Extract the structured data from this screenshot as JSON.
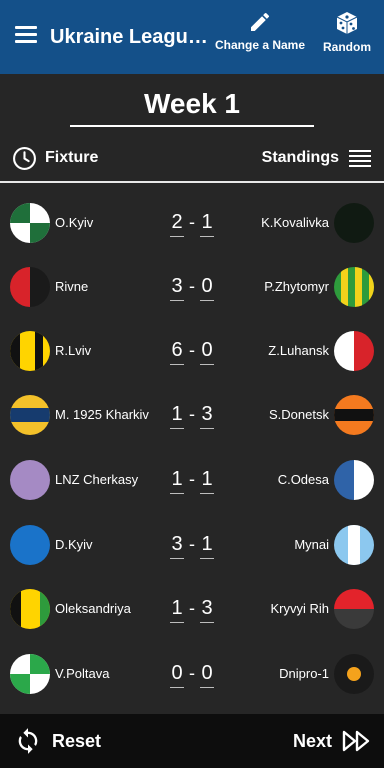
{
  "header": {
    "title": "Ukraine League...",
    "rename_label": "Change a Name",
    "random_label": "Random",
    "menu_icon": "hamburger-menu-icon",
    "rename_icon": "pencil-icon",
    "random_icon": "dice-icon",
    "color": "#145089"
  },
  "week": {
    "title": "Week 1"
  },
  "tabs": {
    "fixture_label": "Fixture",
    "standings_label": "Standings",
    "fixture_icon": "clock-icon",
    "standings_icon": "list-icon"
  },
  "matches": [
    {
      "home": "O.Kyiv",
      "away": "K.Kovalivka",
      "home_goals": "2",
      "away_goals": "1",
      "separator": "-"
    },
    {
      "home": "Rivne",
      "away": "P.Zhytomyr",
      "home_goals": "3",
      "away_goals": "0",
      "separator": "-"
    },
    {
      "home": "R.Lviv",
      "away": "Z.Luhansk",
      "home_goals": "6",
      "away_goals": "0",
      "separator": "-"
    },
    {
      "home": "M. 1925 Kharkiv",
      "away": "S.Donetsk",
      "home_goals": "1",
      "away_goals": "3",
      "separator": "-"
    },
    {
      "home": "LNZ Cherkasy",
      "away": "C.Odesa",
      "home_goals": "1",
      "away_goals": "1",
      "separator": "-"
    },
    {
      "home": "D.Kyiv",
      "away": "Mynai",
      "home_goals": "3",
      "away_goals": "1",
      "separator": "-"
    },
    {
      "home": "Oleksandriya",
      "away": "Kryvyi Rih",
      "home_goals": "1",
      "away_goals": "3",
      "separator": "-"
    },
    {
      "home": "V.Poltava",
      "away": "Dnipro-1",
      "home_goals": "0",
      "away_goals": "0",
      "separator": "-"
    }
  ],
  "footer": {
    "reset_label": "Reset",
    "next_label": "Next",
    "reset_icon": "refresh-icon",
    "next_icon": "fast-forward-icon"
  }
}
